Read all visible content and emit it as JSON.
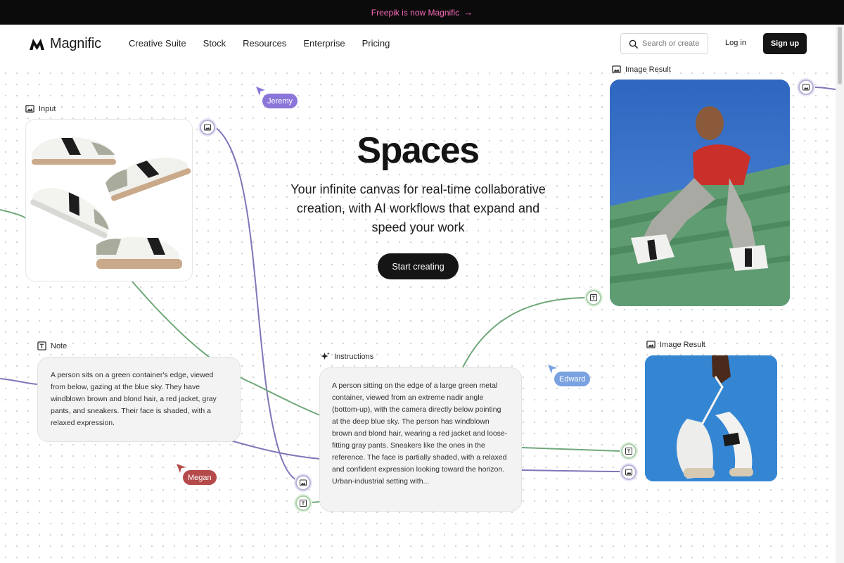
{
  "banner": {
    "text": "Freepik is now Magnific",
    "arrow": "→"
  },
  "nav": {
    "logo_text": "Magnific",
    "links": [
      "Creative Suite",
      "Stock",
      "Resources",
      "Enterprise",
      "Pricing"
    ],
    "search_placeholder": "Search or create",
    "login_label": "Log in",
    "signup_label": "Sign up"
  },
  "hero": {
    "title": "Spaces",
    "subtitle": "Your infinite canvas for real-time collaborative creation, with AI workflows that expand and speed your work",
    "cta_label": "Start creating"
  },
  "nodes": {
    "input_label": "Input",
    "image_result_label": "Image Result",
    "image_result2_label": "Image Result",
    "note_label": "Note",
    "note_text": "A person sits on a green container's edge, viewed from below, gazing at the blue sky. They have windblown brown and blond hair, a red jacket, gray pants, and sneakers. Their face is shaded, with a relaxed expression.",
    "instructions_label": "Instructions",
    "instructions_text": "A person sitting on the edge of a large green metal container, viewed from an extreme nadir angle (bottom-up), with the camera directly below pointing at the deep blue sky. The person has windblown brown and blond hair, wearing a red jacket and loose-fitting gray pants. Sneakers like the ones in the reference. The face is partially shaded, with a relaxed and confident expression looking toward the horizon. Urban-industrial setting with..."
  },
  "collaborators": [
    "Jeremy",
    "Edward",
    "Megan"
  ],
  "colors": {
    "banner_text": "#f76ab8",
    "wire_purple": "#7e77b8",
    "wire_green": "#6fa879",
    "jeremy": "#8a75d9",
    "edward": "#7aa2e0",
    "megan": "#b54a4a"
  }
}
